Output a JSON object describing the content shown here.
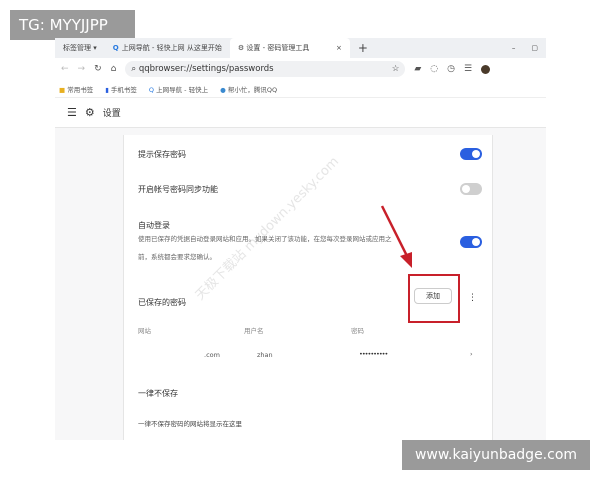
{
  "watermarks": {
    "top_left": "TG: MYYJJPP",
    "bottom_right": "www.kaiyunbadge.com",
    "diagonal": "天极下载站 mydown.yesky.com"
  },
  "tabs": [
    {
      "label": "标签管理 ▾"
    },
    {
      "label": "上网导航 - 轻快上网 从这里开始"
    },
    {
      "label": "设置 - 密码管理工具",
      "active": true
    }
  ],
  "tab_close": "×",
  "new_tab": "+",
  "address": {
    "url": "qqbrowser://settings/passwords"
  },
  "bookmarks": [
    "常用书签",
    "手机书签",
    "上网导航 - 轻快上",
    "帮小忙，腾讯QQ"
  ],
  "header": {
    "title": "设置"
  },
  "settings": {
    "offer_save": {
      "label": "提示保存密码",
      "on": true
    },
    "sync": {
      "label": "开启帐号密码同步功能",
      "on": false
    },
    "auto_login": {
      "label": "自动登录",
      "desc1": "使用已保存的凭据自动登录网站和应用。如果关闭了该功能，在您每次登录网站或应用之",
      "desc2": "前，系统都会要求您确认。",
      "on": true
    }
  },
  "saved": {
    "title": "已保存的密码",
    "add": "添加",
    "more": "⋮",
    "columns": [
      "网站",
      "用户名",
      "密码"
    ],
    "rows": [
      {
        "site": ".com",
        "user": "zhan",
        "password": "••••••••••"
      }
    ]
  },
  "never": {
    "title": "一律不保存",
    "empty": "一律不保存密码的网站将显示在这里"
  },
  "colors": {
    "accent": "#2a5fe0",
    "annotation": "#c8202a"
  }
}
